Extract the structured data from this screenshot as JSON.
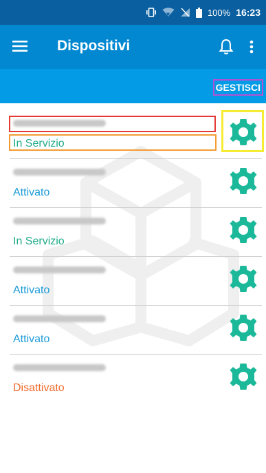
{
  "statusbar": {
    "battery_text": "100%",
    "time": "16:23",
    "icons": [
      "vibrate-icon",
      "wifi-icon",
      "no-signal-icon",
      "battery-icon"
    ]
  },
  "appbar": {
    "title": "Dispositivi",
    "icons": [
      "hamburger-menu-icon",
      "bell-icon",
      "overflow-menu-icon"
    ]
  },
  "subbar": {
    "manage_label": "GESTISCI"
  },
  "devices": [
    {
      "status": "In Servizio",
      "status_color": "#1fab89"
    },
    {
      "status": "Attivato",
      "status_color": "#1e9bd7"
    },
    {
      "status": "In Servizio",
      "status_color": "#1fab89"
    },
    {
      "status": "Attivato",
      "status_color": "#1e9bd7"
    },
    {
      "status": "Attivato",
      "status_color": "#1e9bd7"
    },
    {
      "status": "Disattivato",
      "status_color": "#f06b2b"
    }
  ],
  "colors": {
    "statusbar_bg": "#0a5fa0",
    "appbar_bg": "#0288d1",
    "subbar_bg": "#039be5",
    "gear": "#1bb99a"
  }
}
